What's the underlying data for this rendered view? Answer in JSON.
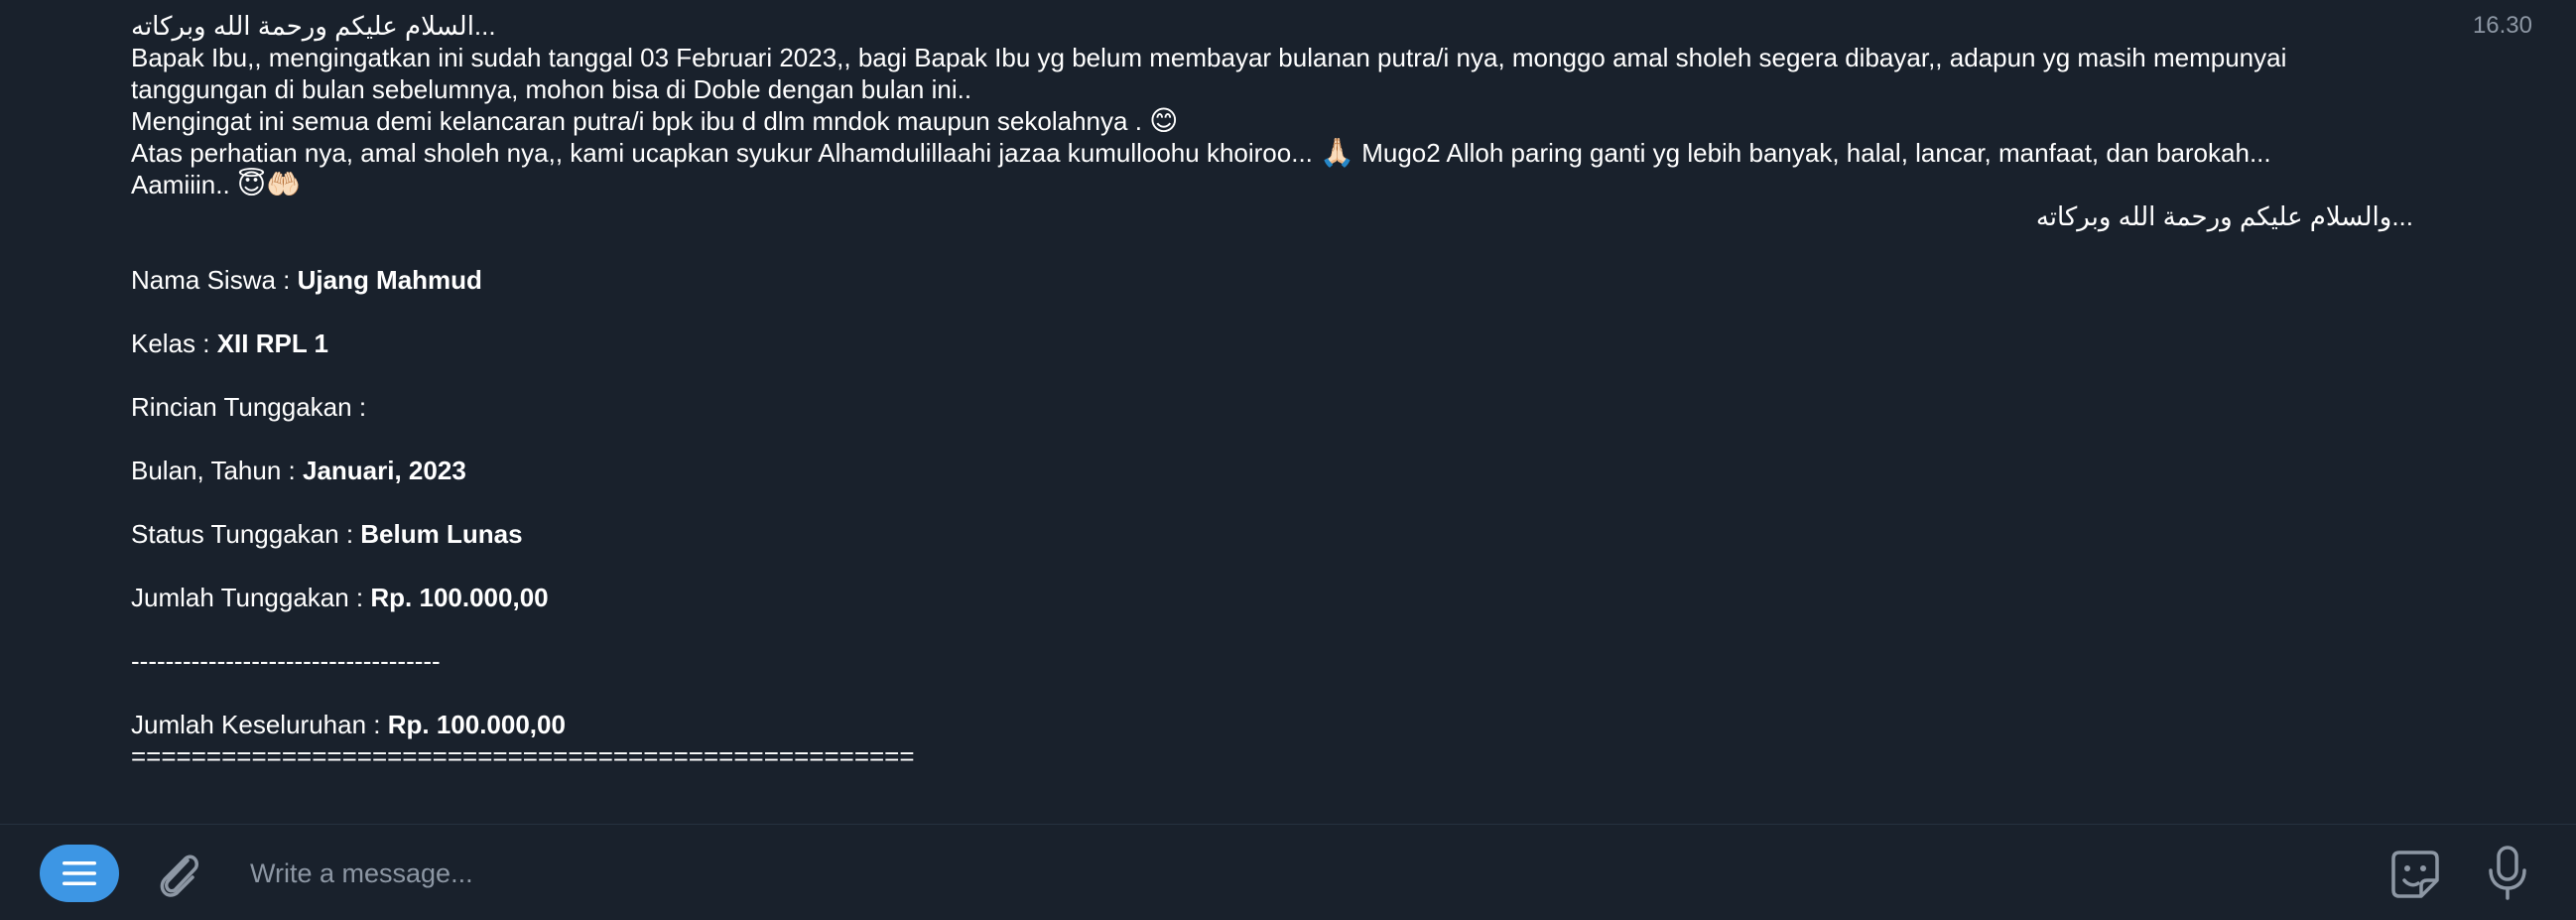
{
  "message": {
    "time": "16.30",
    "lines": {
      "greeting_open": "...السلام عليكم ورحمة الله وبركاته",
      "line1": "Bapak Ibu,, mengingatkan ini sudah tanggal 03 Februari 2023,, bagi Bapak Ibu yg belum membayar bulanan putra/i nya, monggo amal sholeh segera dibayar,, adapun yg masih mempunyai",
      "line2": "tanggungan di bulan sebelumnya, mohon bisa di Doble dengan bulan ini..",
      "line3_text": "Mengingat ini semua demi kelancaran putra/i bpk ibu d dlm mndok maupun sekolahnya . ",
      "line3_emoji": "😊",
      "line4_text_a": "Atas perhatian nya, amal sholeh nya,, kami ucapkan syukur Alhamdulillaahi jazaa kumulloohu khoiroo... ",
      "line4_emoji": "🙏🏻",
      "line4_text_b": " Mugo2 Alloh paring ganti yg lebih banyak, halal, lancar, manfaat, dan barokah...",
      "line5_text": "Aamiiin.. ",
      "line5_emoji": "😇🤲🏻",
      "greeting_close": "...والسلام عليكم ورحمة الله وبركاته"
    },
    "details": {
      "nama_label": "Nama Siswa : ",
      "nama_value": "Ujang Mahmud",
      "kelas_label": "Kelas : ",
      "kelas_value": "XII RPL 1",
      "rincian_label": "Rincian Tunggakan :",
      "bulan_label": "Bulan, Tahun : ",
      "bulan_value": "Januari, 2023",
      "status_label": "Status Tunggakan : ",
      "status_value": "Belum Lunas",
      "jumlah_label": "Jumlah Tunggakan : ",
      "jumlah_value": "Rp. 100.000,00",
      "separator_dash": "------------------------------------",
      "total_label": "Jumlah Keseluruhan : ",
      "total_value": "Rp. 100.000,00",
      "separator_equals": "===================================================="
    }
  },
  "composer": {
    "placeholder": "Write a message...",
    "icons": {
      "menu": "menu-icon",
      "attach": "paperclip-icon",
      "sticker": "sticker-icon",
      "mic": "microphone-icon"
    }
  },
  "colors": {
    "background": "#19212c",
    "accent": "#3d96e4",
    "muted_text": "#8d97a4"
  }
}
